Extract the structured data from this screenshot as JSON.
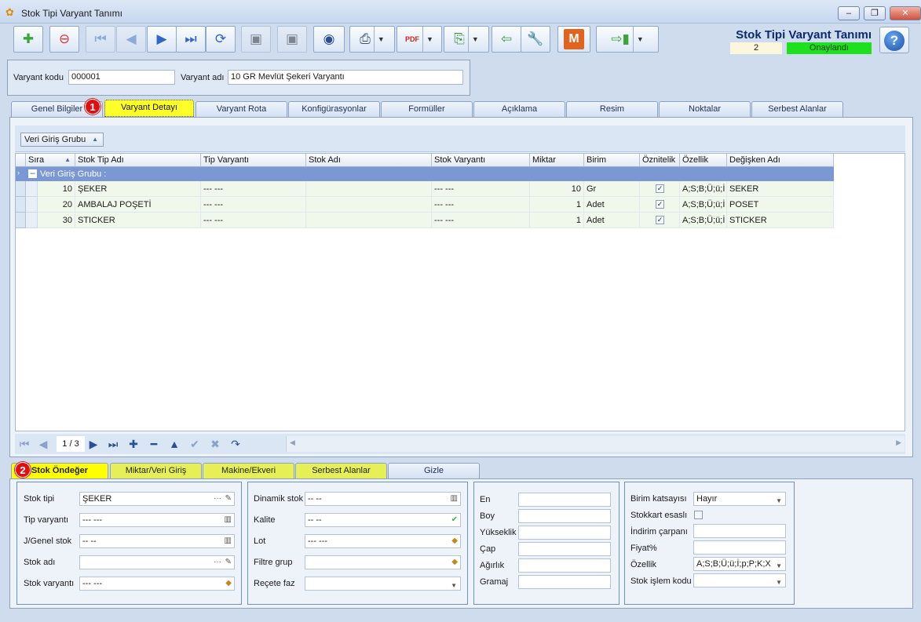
{
  "window": {
    "title": "Stok Tipi Varyant Tanımı",
    "minimize": "–",
    "maximize": "❐",
    "close": "✕"
  },
  "toolbar": {
    "buttons": [
      {
        "name": "new-record-button",
        "icon": "📄"
      },
      {
        "name": "delete-record-button",
        "icon": "⊖"
      },
      {
        "name": "first-record-button",
        "icon": "⏮"
      },
      {
        "name": "previous-record-button",
        "icon": "◀"
      },
      {
        "name": "next-record-button",
        "icon": "▶"
      },
      {
        "name": "last-record-button",
        "icon": "⏭"
      },
      {
        "name": "refresh-button",
        "icon": "⟳"
      },
      {
        "name": "save-button",
        "icon": "💾"
      },
      {
        "name": "save-cancel-button",
        "icon": "💾"
      },
      {
        "name": "preview-button",
        "icon": "👁"
      },
      {
        "name": "print-button",
        "icon": "🖨"
      },
      {
        "name": "pdf-export-button",
        "icon": "PDF"
      },
      {
        "name": "copy-button",
        "icon": "⎘"
      },
      {
        "name": "import-button",
        "icon": "⇦"
      },
      {
        "name": "settings-tool-button",
        "icon": "🔧"
      },
      {
        "name": "m-button",
        "icon": "M"
      },
      {
        "name": "exit-button",
        "icon": "⇨"
      }
    ]
  },
  "header": {
    "form_title": "Stok Tipi Varyant Tanımı",
    "status_number": "2",
    "status": "Onaylandı",
    "help": "?"
  },
  "fields": {
    "variant_code_label": "Varyant kodu",
    "variant_code": "000001",
    "variant_name_label": "Varyant adı",
    "variant_name": "10 GR Mevlüt Şekeri Varyantı"
  },
  "tabs": [
    "Genel Bilgiler",
    "Varyant Detayı",
    "Varyant Rota",
    "Konfigürasyonlar",
    "Formüller",
    "Açıklama",
    "Resim",
    "Noktalar",
    "Serbest Alanlar"
  ],
  "markers": {
    "one": "1",
    "two": "2"
  },
  "grid": {
    "group_chip": "Veri Giriş Grubu",
    "columns": [
      "Sıra",
      "Stok Tip Adı",
      "Tip Varyantı",
      "Stok Adı",
      "Stok Varyantı",
      "Miktar",
      "Birim",
      "Öznitelik",
      "Özellik",
      "Değişken Adı"
    ],
    "group_row": "Veri Giriş Grubu :",
    "rows": [
      {
        "sira": "10",
        "stok_tip_adi": "ŞEKER",
        "tip_varyanti": "--- ---",
        "stok_adi": "",
        "stok_varyanti": "--- ---",
        "miktar": "10",
        "birim": "Gr",
        "oznitelik": "✓",
        "ozellik": "A;S;B;Ü;ü;İ",
        "degisken_adi": "SEKER"
      },
      {
        "sira": "20",
        "stok_tip_adi": "AMBALAJ POŞETİ",
        "tip_varyanti": "--- ---",
        "stok_adi": "",
        "stok_varyanti": "--- ---",
        "miktar": "1",
        "birim": "Adet",
        "oznitelik": "✓",
        "ozellik": "A;S;B;Ü;ü;İ",
        "degisken_adi": "POSET"
      },
      {
        "sira": "30",
        "stok_tip_adi": "STICKER",
        "tip_varyanti": "--- ---",
        "stok_adi": "",
        "stok_varyanti": "--- ---",
        "miktar": "1",
        "birim": "Adet",
        "oznitelik": "✓",
        "ozellik": "A;S;B;Ü;ü;İ",
        "degisken_adi": "STICKER"
      }
    ],
    "pager": "1 / 3"
  },
  "bottom_tabs": [
    "Stok Öndeğer",
    "Miktar/Veri Giriş",
    "Makine/Ekveri",
    "Serbest Alanlar",
    "Gizle"
  ],
  "defaults": {
    "stok_tipi_label": "Stok tipi",
    "stok_tipi": "ŞEKER",
    "tip_varyanti_label": "Tip varyantı",
    "tip_varyanti": "--- ---",
    "j_genel_stok_label": "J/Genel stok",
    "j_genel_stok": "-- --",
    "stok_adi_label": "Stok adı",
    "stok_adi": "",
    "stok_varyanti_label": "Stok varyantı",
    "stok_varyanti": "--- ---",
    "dinamik_stok_label": "Dinamik stok",
    "dinamik_stok": "-- --",
    "kalite_label": "Kalite",
    "kalite": "-- --",
    "lot_label": "Lot",
    "lot": "--- ---",
    "filtre_grup_label": "Filtre grup",
    "filtre_grup": "",
    "recete_faz_label": "Reçete faz",
    "recete_faz": "",
    "en_label": "En",
    "boy_label": "Boy",
    "yukseklik_label": "Yükseklik",
    "cap_label": "Çap",
    "agirlik_label": "Ağırlık",
    "gramaj_label": "Gramaj",
    "birim_katsayisi_label": "Birim katsayısı",
    "birim_katsayisi": "Hayır",
    "stokkart_esasli_label": "Stokkart esaslı",
    "indirim_carpani_label": "İndirim çarpanı",
    "fiyat_label": "Fiyat%",
    "ozellik_label": "Özellik",
    "ozellik": "A;S;B;Ü;ü;İ;p;P;K;X",
    "stok_islem_kodu_label": "Stok işlem kodu",
    "stok_islem_kodu": ""
  }
}
